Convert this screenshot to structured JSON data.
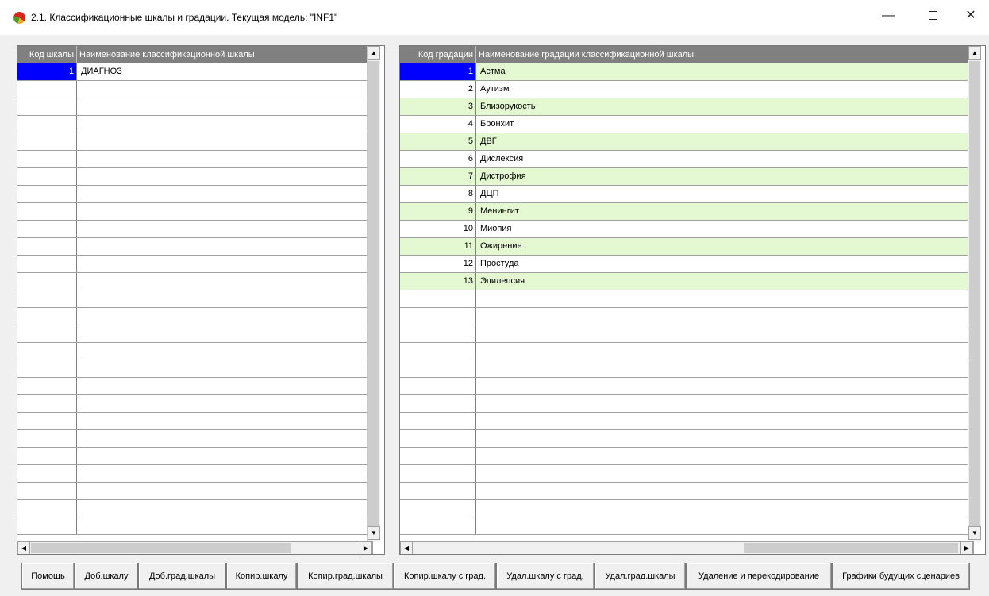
{
  "window": {
    "title": "2.1. Классификационные шкалы и градации. Текущая модель: \"INF1\"",
    "icon": "app-logo-icon",
    "controls": {
      "minimize": "—",
      "close": "✕"
    }
  },
  "scales_table": {
    "headers": [
      "Код шкалы",
      "Наименование классификационной шкалы"
    ],
    "rows": [
      {
        "code": "1",
        "name": "ДИАГНОЗ"
      }
    ],
    "selected_row": 0
  },
  "gradations_table": {
    "headers": [
      "Код градации",
      "Наименование градации классификационной шкалы"
    ],
    "rows": [
      {
        "code": "1",
        "name": "Астма"
      },
      {
        "code": "2",
        "name": "Аутизм"
      },
      {
        "code": "3",
        "name": "Близорукость"
      },
      {
        "code": "4",
        "name": "Бронхит"
      },
      {
        "code": "5",
        "name": "ДВГ"
      },
      {
        "code": "6",
        "name": "Дислексия"
      },
      {
        "code": "7",
        "name": "Дистрофия"
      },
      {
        "code": "8",
        "name": "ДЦП"
      },
      {
        "code": "9",
        "name": "Менингит"
      },
      {
        "code": "10",
        "name": "Миопия"
      },
      {
        "code": "11",
        "name": "Ожирение"
      },
      {
        "code": "12",
        "name": "Простуда"
      },
      {
        "code": "13",
        "name": "Эпилепсия"
      }
    ],
    "selected_row": 0,
    "highlight_color": "#e4f8d2"
  },
  "buttons": [
    "Помощь",
    "Доб.шкалу",
    "Доб.град.шкалы",
    "Копир.шкалу",
    "Копир.град.шкалы",
    "Копир.шкалу с град.",
    "Удал.шкалу с град.",
    "Удал.град.шкалы",
    "Удаление и перекодирование",
    "Графики будущих сценариев"
  ],
  "colors": {
    "header_bg": "#808080",
    "selection": "#0000ff",
    "row_alt": "#e4f8d2"
  }
}
